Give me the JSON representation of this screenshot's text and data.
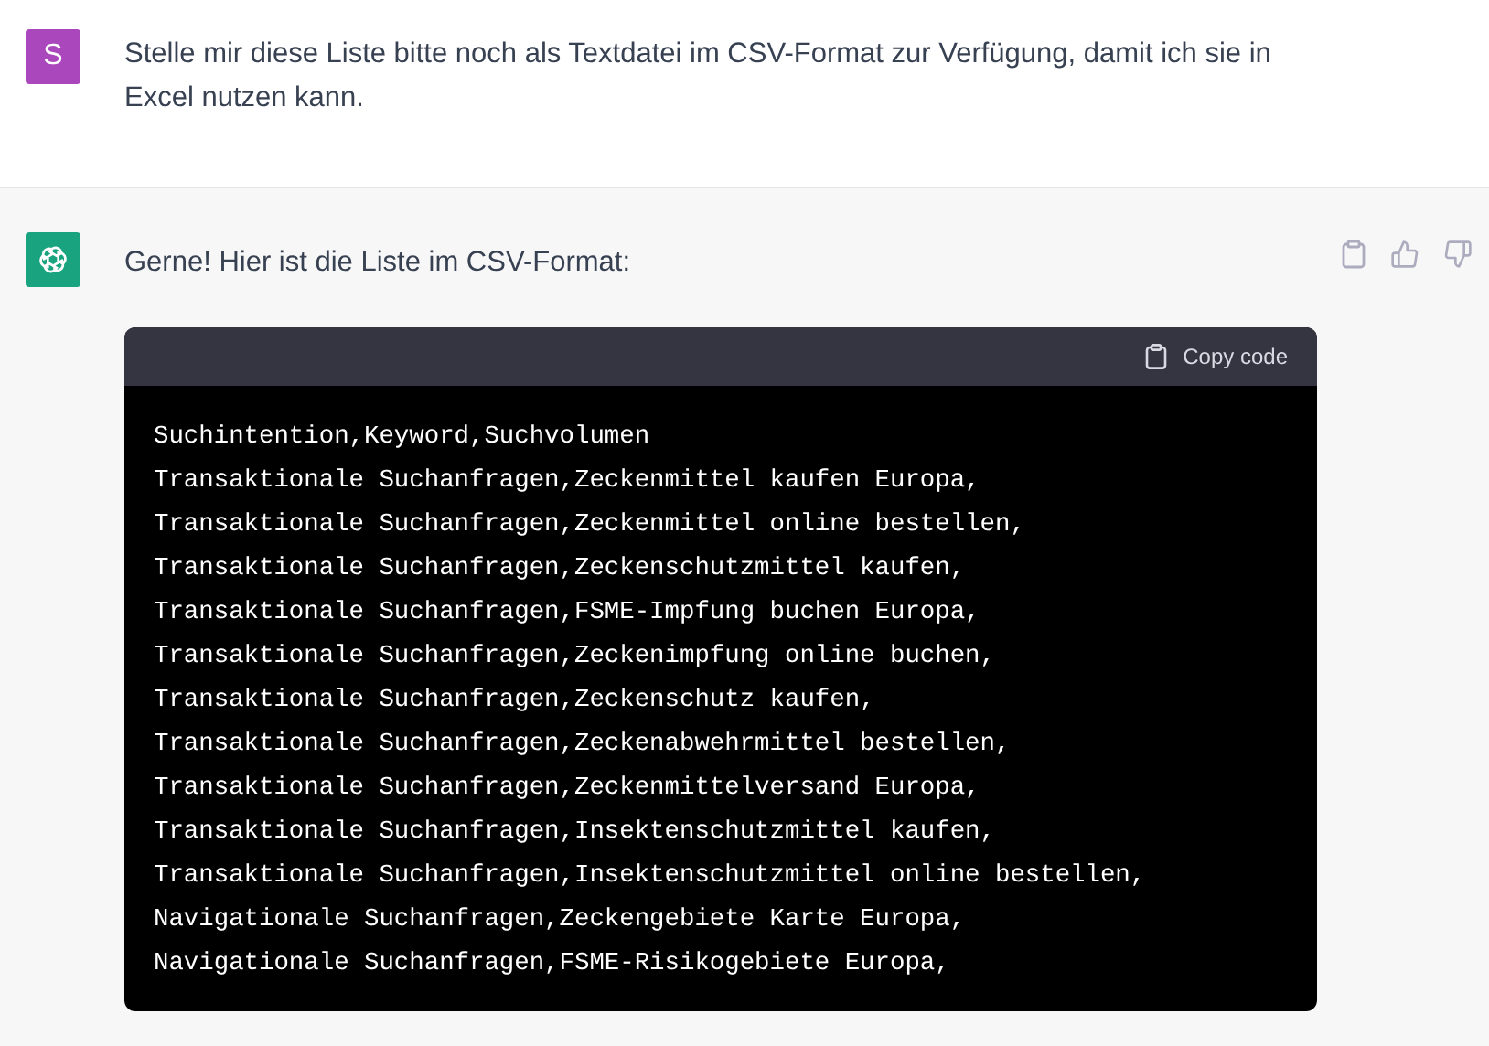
{
  "messages": [
    {
      "kind": "user",
      "avatar_letter": "S",
      "text": "Stelle mir diese Liste bitte noch als Textdatei im CSV-Format zur Verfügung, damit ich sie in Excel nutzen kann."
    },
    {
      "kind": "assistant",
      "text": "Gerne! Hier ist die Liste im CSV-Format:",
      "code_block": {
        "copy_label": "Copy code",
        "lines": [
          "Suchintention,Keyword,Suchvolumen",
          "Transaktionale Suchanfragen,Zeckenmittel kaufen Europa,",
          "Transaktionale Suchanfragen,Zeckenmittel online bestellen,",
          "Transaktionale Suchanfragen,Zeckenschutzmittel kaufen,",
          "Transaktionale Suchanfragen,FSME-Impfung buchen Europa,",
          "Transaktionale Suchanfragen,Zeckenimpfung online buchen,",
          "Transaktionale Suchanfragen,Zeckenschutz kaufen,",
          "Transaktionale Suchanfragen,Zeckenabwehrmittel bestellen,",
          "Transaktionale Suchanfragen,Zeckenmittelversand Europa,",
          "Transaktionale Suchanfragen,Insektenschutzmittel kaufen,",
          "Transaktionale Suchanfragen,Insektenschutzmittel online bestellen,",
          "Navigationale Suchanfragen,Zeckengebiete Karte Europa,",
          "Navigationale Suchanfragen,FSME-Risikogebiete Europa,"
        ]
      }
    }
  ]
}
